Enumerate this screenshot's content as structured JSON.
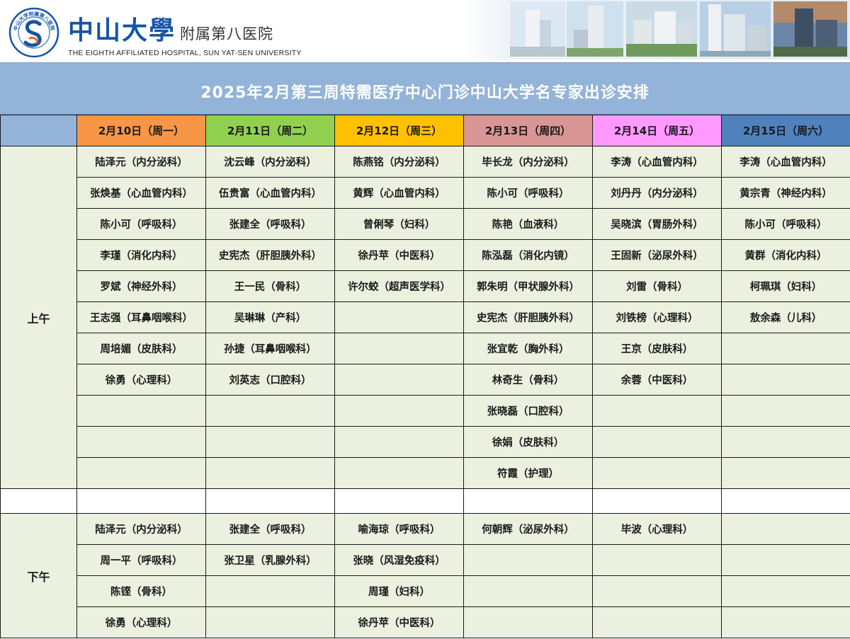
{
  "header": {
    "seal_text": "中山大学附属第八医院",
    "brand_cn_main": "中山大學",
    "brand_cn_sub": "附属第八医院",
    "brand_en": "THE EIGHTH AFFILIATED HOSPITAL, SUN YAT-SEN UNIVERSITY"
  },
  "colors": {
    "brand_blue": "#1554a8",
    "title_band": "#93b3d8",
    "cell_green": "#ebf1de",
    "day_colors": [
      "#f79646",
      "#92d050",
      "#ffc000",
      "#da9694",
      "#ff99ff",
      "#4f81bd"
    ]
  },
  "title": "2025年2月第三周特需医疗中心门诊中山大学名专家出诊安排",
  "days": [
    "2月10日（周一）",
    "2月11日（周二）",
    "2月12日（周三）",
    "2月13日（周四）",
    "2月14日（周五）",
    "2月15日（周六）"
  ],
  "periods": [
    {
      "label": "上午",
      "columns": [
        [
          "陆泽元（内分泌科）",
          "张焕基（心血管内科）",
          "陈小可（呼吸科）",
          "李瑾（消化内科）",
          "罗斌（神经外科）",
          "王志强（耳鼻咽喉科）",
          "周培媚（皮肤科）",
          "徐勇（心理科）",
          "",
          "",
          ""
        ],
        [
          "沈云峰（内分泌科）",
          "伍贵富（心血管内科）",
          "张建全（呼吸科）",
          "史宪杰（肝胆胰外科）",
          "王一民（骨科）",
          "吴琳琳（产科）",
          "孙捷（耳鼻咽喉科）",
          "刘英志（口腔科）",
          "",
          "",
          ""
        ],
        [
          "陈燕铭（内分泌科）",
          "黄辉（心血管内科）",
          "曾俐琴（妇科）",
          "徐丹苹（中医科）",
          "许尔蛟（超声医学科）",
          "",
          "",
          "",
          "",
          "",
          ""
        ],
        [
          "毕长龙（内分泌科）",
          "陈小可（呼吸科）",
          "陈艳（血液科）",
          "陈泓磊（消化内镜）",
          "郭朱明（甲状腺外科）",
          "史宪杰（肝胆胰外科）",
          "张宜乾（胸外科）",
          "林奇生（骨科）",
          "张晓磊（口腔科）",
          "徐娟（皮肤科）",
          "符霞（护理）"
        ],
        [
          "李涛（心血管内科）",
          "刘丹丹（内分泌科）",
          "吴晓滨（胃肠外科）",
          "王固新（泌尿外科）",
          "刘雷（骨科）",
          "刘铁榜（心理科）",
          "王京（皮肤科）",
          "余蓉（中医科）",
          "",
          "",
          ""
        ],
        [
          "李涛（心血管内科）",
          "黄宗青（神经内科）",
          "陈小可（呼吸科）",
          "黄群（消化内科）",
          "柯珮琪（妇科）",
          "敖余森（儿科）",
          "",
          "",
          "",
          "",
          ""
        ]
      ]
    },
    {
      "label": "下午",
      "columns": [
        [
          "陆泽元（内分泌科）",
          "周一平（呼吸科）",
          "陈铿（骨科）",
          "徐勇（心理科）"
        ],
        [
          "张建全（呼吸科）",
          "张卫星（乳腺外科）",
          "",
          ""
        ],
        [
          "喻海琼（呼吸科）",
          "张晓（风湿免疫科）",
          "周瑾（妇科）",
          "徐丹苹（中医科）"
        ],
        [
          "何朝辉（泌尿外科）",
          "",
          "",
          ""
        ],
        [
          "毕波（心理科）",
          "",
          "",
          ""
        ],
        [
          "",
          "",
          "",
          ""
        ]
      ]
    }
  ]
}
